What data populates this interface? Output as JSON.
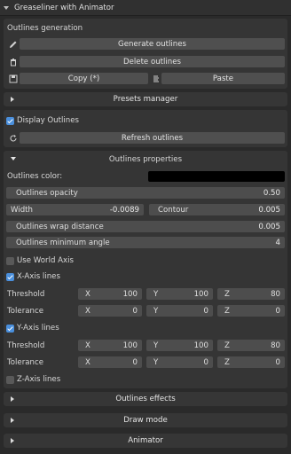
{
  "title": "Greaseliner with Animator",
  "outlines_generation": {
    "heading": "Outlines generation",
    "generate": "Generate outlines",
    "delete": "Delete outlines",
    "copy": "Copy (*)",
    "paste": "Paste"
  },
  "presets_manager": "Presets manager",
  "display_outlines": {
    "label": "Display Outlines",
    "checked": true
  },
  "refresh": "Refresh outlines",
  "outlines_properties": {
    "heading": "Outlines properties",
    "color_label": "Outlines color:",
    "color_value": "#000000",
    "opacity": {
      "label": "Outlines opacity",
      "value": "0.50"
    },
    "width": {
      "label": "Width",
      "value": "-0.0089"
    },
    "contour": {
      "label": "Contour",
      "value": "0.005"
    },
    "wrap_distance": {
      "label": "Outlines wrap distance",
      "value": "0.005"
    },
    "min_angle": {
      "label": "Outlines minimum angle",
      "value": "4"
    },
    "use_world_axis": {
      "label": "Use World Axis",
      "checked": false
    }
  },
  "x_axis": {
    "label": "X-Axis lines",
    "checked": true,
    "threshold": {
      "label": "Threshold",
      "x": "100",
      "y": "100",
      "z": "80"
    },
    "tolerance": {
      "label": "Tolerance",
      "x": "0",
      "y": "0",
      "z": "0"
    }
  },
  "y_axis": {
    "label": "Y-Axis lines",
    "checked": true,
    "threshold": {
      "label": "Threshold",
      "x": "100",
      "y": "100",
      "z": "80"
    },
    "tolerance": {
      "label": "Tolerance",
      "x": "0",
      "y": "0",
      "z": "0"
    }
  },
  "z_axis": {
    "label": "Z-Axis lines",
    "checked": false
  },
  "axis_letters": {
    "x": "X",
    "y": "Y",
    "z": "Z"
  },
  "sections": {
    "effects": "Outlines effects",
    "draw_mode": "Draw mode",
    "animator": "Animator"
  },
  "colors": {
    "checkbox_on": "#4a8fdc",
    "button": "#4f4f4f",
    "panel": "#353535"
  },
  "icons": [
    "chevron-down-icon",
    "pencil-icon",
    "trash-icon",
    "save-icon",
    "paste-icon",
    "refresh-icon",
    "chevron-right-icon"
  ]
}
